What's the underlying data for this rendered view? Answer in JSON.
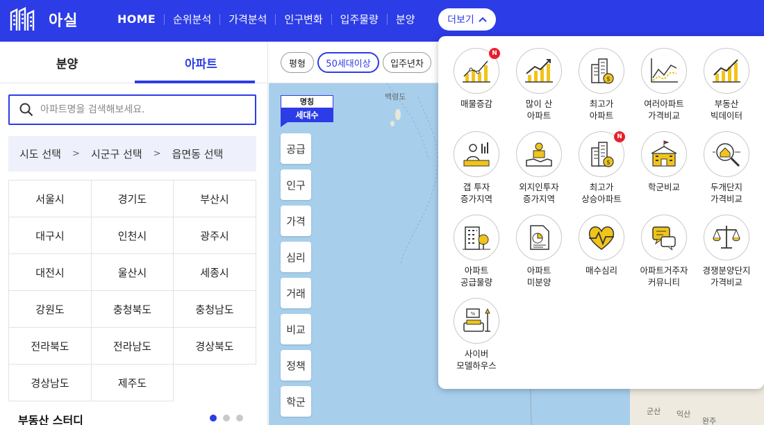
{
  "header": {
    "logo_text": "아실",
    "nav": [
      "HOME",
      "순위분석",
      "가격분석",
      "인구변화",
      "입주물량",
      "분양"
    ],
    "more_label": "더보기"
  },
  "left": {
    "tabs": [
      "분양",
      "아파트"
    ],
    "search_placeholder": "아파트명을 검색해보세요.",
    "region": [
      "시도 선택",
      "시군구 선택",
      "읍면동 선택"
    ],
    "region_sep": ">",
    "provinces": [
      "서울시",
      "경기도",
      "부산시",
      "대구시",
      "인천시",
      "광주시",
      "대전시",
      "울산시",
      "세종시",
      "강원도",
      "충청북도",
      "충청남도",
      "전라북도",
      "전라남도",
      "경상북도",
      "경상남도",
      "제주도"
    ],
    "study_title": "부동산 스터디"
  },
  "map": {
    "chips": [
      "평형",
      "50세대이상",
      "입주년차"
    ],
    "legend": [
      "명칭",
      "세대수"
    ],
    "side_buttons": [
      "공급",
      "인구",
      "가격",
      "심리",
      "거래",
      "비교",
      "정책",
      "학군"
    ],
    "labels": [
      "백령도",
      "군산",
      "익산",
      "완주"
    ]
  },
  "dropdown": {
    "items": [
      {
        "label": "매물증감",
        "icon": "chart-growth-icon",
        "badge": "N"
      },
      {
        "label": "많이 산\n아파트",
        "icon": "rising-chart-icon",
        "badge": ""
      },
      {
        "label": "최고가\n아파트",
        "icon": "building-coin-icon",
        "badge": ""
      },
      {
        "label": "여러아파트\n가격비교",
        "icon": "line-compare-icon",
        "badge": ""
      },
      {
        "label": "부동산\n빅데이터",
        "icon": "bigdata-chart-icon",
        "badge": ""
      },
      {
        "label": "갭 투자\n증가지역",
        "icon": "gap-investment-icon",
        "badge": ""
      },
      {
        "label": "외지인투자\n증가지역",
        "icon": "hand-money-icon",
        "badge": ""
      },
      {
        "label": "최고가\n상승아파트",
        "icon": "building-coin-up-icon",
        "badge": "N"
      },
      {
        "label": "학군비교",
        "icon": "school-icon",
        "badge": ""
      },
      {
        "label": "두개단지\n가격비교",
        "icon": "magnifier-house-icon",
        "badge": ""
      },
      {
        "label": "아파트\n공급물량",
        "icon": "apartment-tree-icon",
        "badge": ""
      },
      {
        "label": "아파트\n미분양",
        "icon": "document-pie-icon",
        "badge": ""
      },
      {
        "label": "매수심리",
        "icon": "heart-pulse-icon",
        "badge": ""
      },
      {
        "label": "아파트거주자\n커뮤니티",
        "icon": "chat-bubbles-icon",
        "badge": ""
      },
      {
        "label": "경쟁분양단지\n가격비교",
        "icon": "scale-icon",
        "badge": ""
      },
      {
        "label": "사이버\n모델하우스",
        "icon": "living-room-icon",
        "badge": ""
      }
    ]
  },
  "colors": {
    "primary": "#2c3ce6",
    "badge": "#e8202a",
    "map_sea": "#a7cfec"
  }
}
